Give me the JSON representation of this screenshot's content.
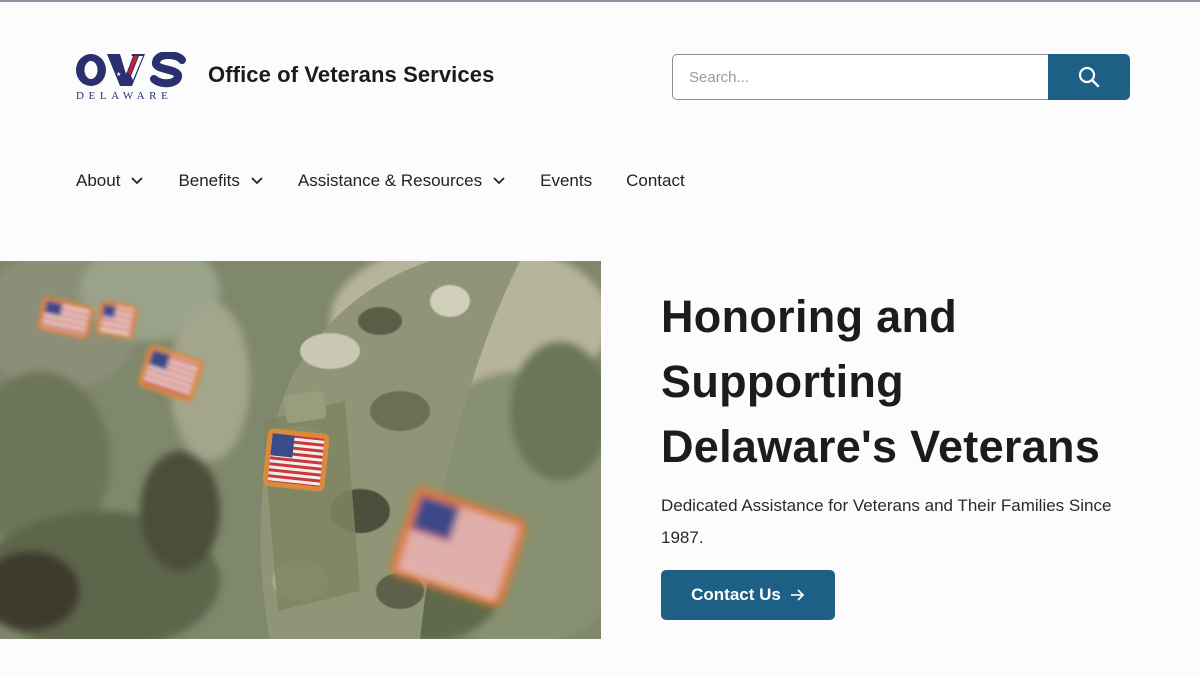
{
  "header": {
    "logo_text": "OVS",
    "logo_subtext": "DELAWARE",
    "site_title": "Office of Veterans Services"
  },
  "search": {
    "placeholder": "Search...",
    "button_icon": "search-icon"
  },
  "nav": {
    "items": [
      {
        "label": "About",
        "has_dropdown": true
      },
      {
        "label": "Benefits",
        "has_dropdown": true
      },
      {
        "label": "Assistance & Resources",
        "has_dropdown": true
      },
      {
        "label": "Events",
        "has_dropdown": false
      },
      {
        "label": "Contact",
        "has_dropdown": false
      }
    ]
  },
  "hero": {
    "title_lines": [
      "Honoring and",
      "Supporting",
      "Delaware's Veterans"
    ],
    "subtitle": "Dedicated Assistance for Veterans and Their Families Since 1987.",
    "cta_label": "Contact Us",
    "cta_icon": "arrow-right-icon",
    "image_icon": "soldiers-flag-patch-photo"
  },
  "colors": {
    "brand_blue": "#1d5f85",
    "logo_navy": "#2a2f6e",
    "logo_red": "#c8202f"
  }
}
